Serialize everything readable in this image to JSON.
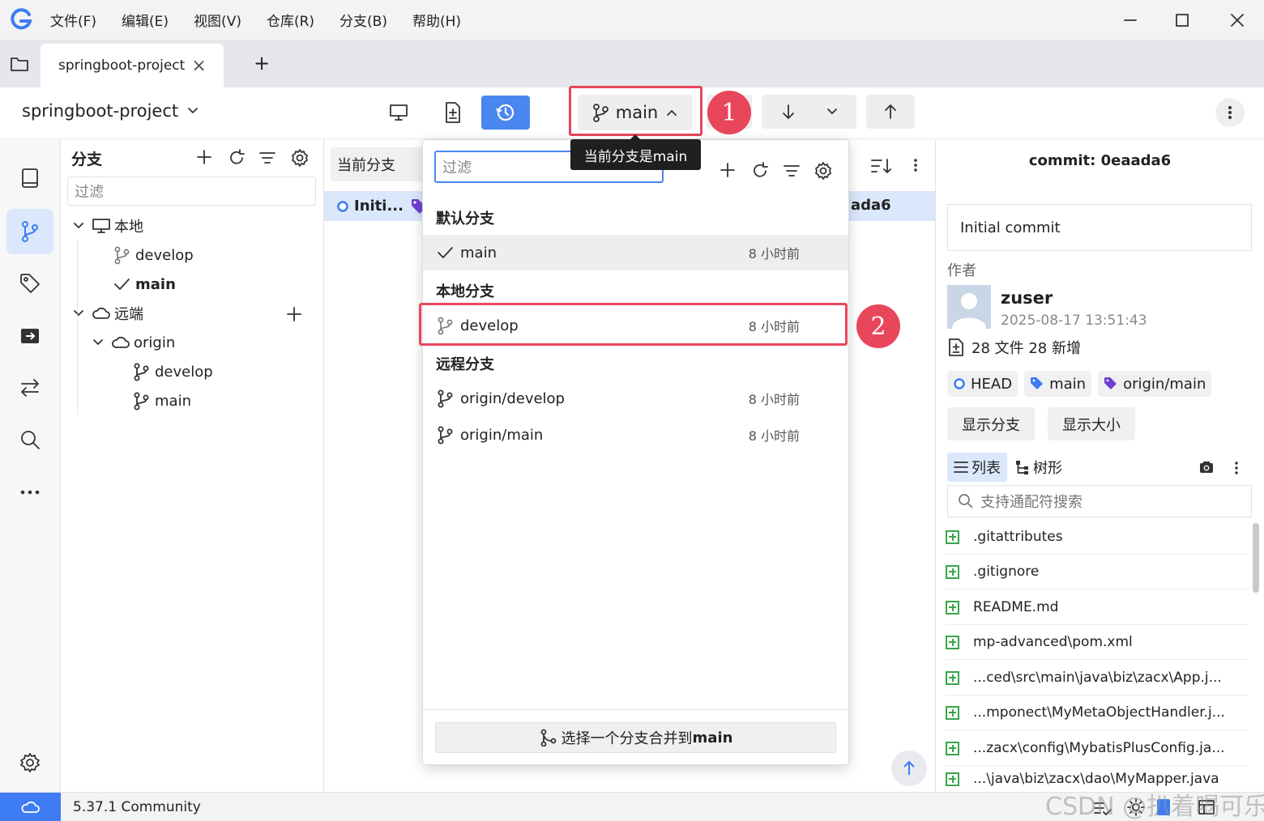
{
  "menu": [
    "文件(F)",
    "编辑(E)",
    "视图(V)",
    "仓库(R)",
    "分支(B)",
    "帮助(H)"
  ],
  "tab": {
    "title": "springboot-project",
    "close": "×",
    "add": "+"
  },
  "toolbar": {
    "repo_name": "springboot-project",
    "branch_label": "main",
    "tooltip": "当前分支是main"
  },
  "annotations": {
    "one": "1",
    "two": "2"
  },
  "branch_panel": {
    "title": "分支",
    "filter_placeholder": "过滤",
    "local_label": "本地",
    "local_branches": [
      "develop",
      "main"
    ],
    "remote_label": "远端",
    "origin_label": "origin",
    "remote_branches": [
      "develop",
      "main"
    ]
  },
  "commit_list": {
    "current_branch_label": "当前分支",
    "row_message": "Initi...",
    "row_hash": "ada6"
  },
  "dropdown": {
    "filter_placeholder": "过滤",
    "default_header": "默认分支",
    "default_branch": {
      "name": "main",
      "time": "8 小时前"
    },
    "local_header": "本地分支",
    "local_branch": {
      "name": "develop",
      "time": "8 小时前"
    },
    "remote_header": "远程分支",
    "remote_branches": [
      {
        "name": "origin/develop",
        "time": "8 小时前"
      },
      {
        "name": "origin/main",
        "time": "8 小时前"
      }
    ],
    "merge_label": "选择一个分支合并到",
    "merge_target": "main"
  },
  "detail": {
    "commit_title": "commit: 0eaada6",
    "message": "Initial commit",
    "author_label": "作者",
    "author_name": "zuser",
    "author_date": "2025-08-17 13:51:43",
    "stats": "28 文件 28 新增",
    "refs": [
      "HEAD",
      "main",
      "origin/main"
    ],
    "show_branch": "显示分支",
    "show_size": "显示大小",
    "view_list": "列表",
    "view_tree": "树形",
    "search_placeholder": "支持通配符搜索",
    "files": [
      ".gitattributes",
      ".gitignore",
      "README.md",
      "mp-advanced\\pom.xml",
      "...ced\\src\\main\\java\\biz\\zacx\\App.j...",
      "...mponect\\MyMetaObjectHandler.j...",
      "...zacx\\config\\MybatisPlusConfig.ja...",
      "...\\java\\biz\\zacx\\dao\\MyMapper.java"
    ]
  },
  "status": {
    "version": "5.37.1 Community",
    "watermark": "CSDN @扒着喝可乐"
  },
  "colors": {
    "accent": "#4a86f0",
    "highlight": "#e8465b",
    "selected_row": "#dbe7fb"
  }
}
